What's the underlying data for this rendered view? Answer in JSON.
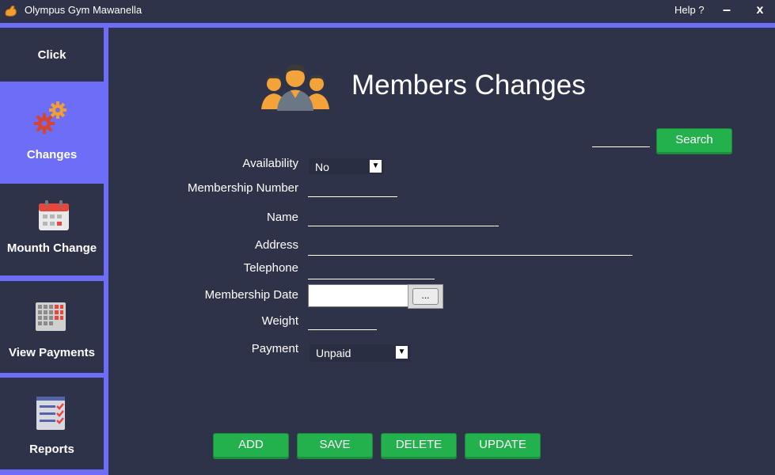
{
  "window": {
    "title": "Olympus Gym Mawanella",
    "help_label": "Help ?",
    "minimize_label": "–",
    "close_label": "x"
  },
  "sidebar": {
    "items": [
      {
        "label": "Click",
        "icon": "none",
        "active": false
      },
      {
        "label": "Changes",
        "icon": "gears-icon",
        "active": true
      },
      {
        "label": "Mounth Change",
        "icon": "calendar-icon",
        "active": false
      },
      {
        "label": "View Payments",
        "icon": "payments-grid-icon",
        "active": false
      },
      {
        "label": "Reports",
        "icon": "checklist-icon",
        "active": false
      }
    ]
  },
  "main": {
    "title": "Members Changes",
    "header_icon": "members-group-icon",
    "search": {
      "value": "",
      "button_label": "Search"
    },
    "form": {
      "availability": {
        "label": "Availability",
        "value": "No"
      },
      "membership_number": {
        "label": "Membership Number",
        "value": ""
      },
      "name": {
        "label": "Name",
        "value": ""
      },
      "address": {
        "label": "Address",
        "value": ""
      },
      "telephone": {
        "label": "Telephone",
        "value": ""
      },
      "membership_date": {
        "label": "Membership Date",
        "value": "",
        "button_label": "..."
      },
      "weight": {
        "label": "Weight",
        "value": ""
      },
      "payment": {
        "label": "Payment",
        "value": "Unpaid"
      }
    },
    "actions": {
      "add": "ADD",
      "save": "SAVE",
      "delete": "DELETE",
      "update": "UPDATE"
    }
  },
  "colors": {
    "background": "#2e3349",
    "accent": "#6d6df7",
    "button_green": "#22b14c"
  }
}
